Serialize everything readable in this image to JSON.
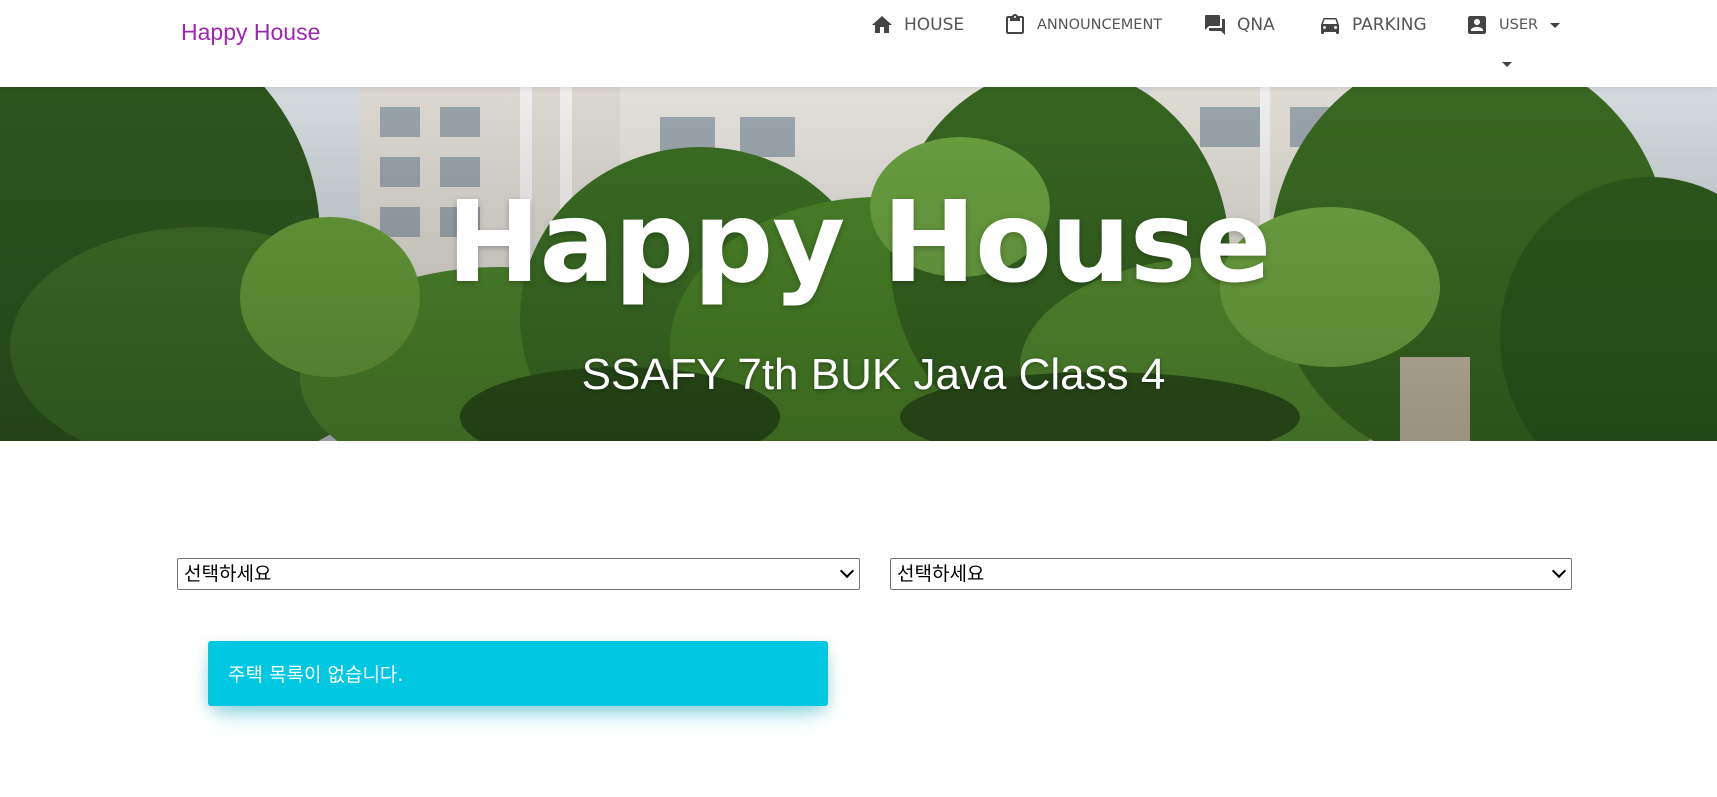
{
  "navbar": {
    "brand": "Happy House",
    "brand_color": "#9c27b0",
    "items": [
      {
        "label": "HOUSE",
        "icon": "home-icon"
      },
      {
        "label": "ANNOUNCEMENT",
        "icon": "clipboard-icon"
      },
      {
        "label": "QNA",
        "icon": "forum-icon"
      },
      {
        "label": "PARKING",
        "icon": "car-icon"
      },
      {
        "label": "USER",
        "icon": "account-box-icon"
      }
    ]
  },
  "hero": {
    "title": "Happy House",
    "subtitle": "SSAFY 7th BUK Java Class 4"
  },
  "filters": {
    "select1": {
      "selected": "선택하세요"
    },
    "select2": {
      "selected": "선택하세요"
    }
  },
  "alert": {
    "message": "주택 목록이 없습니다.",
    "color": "#00c8e3"
  }
}
